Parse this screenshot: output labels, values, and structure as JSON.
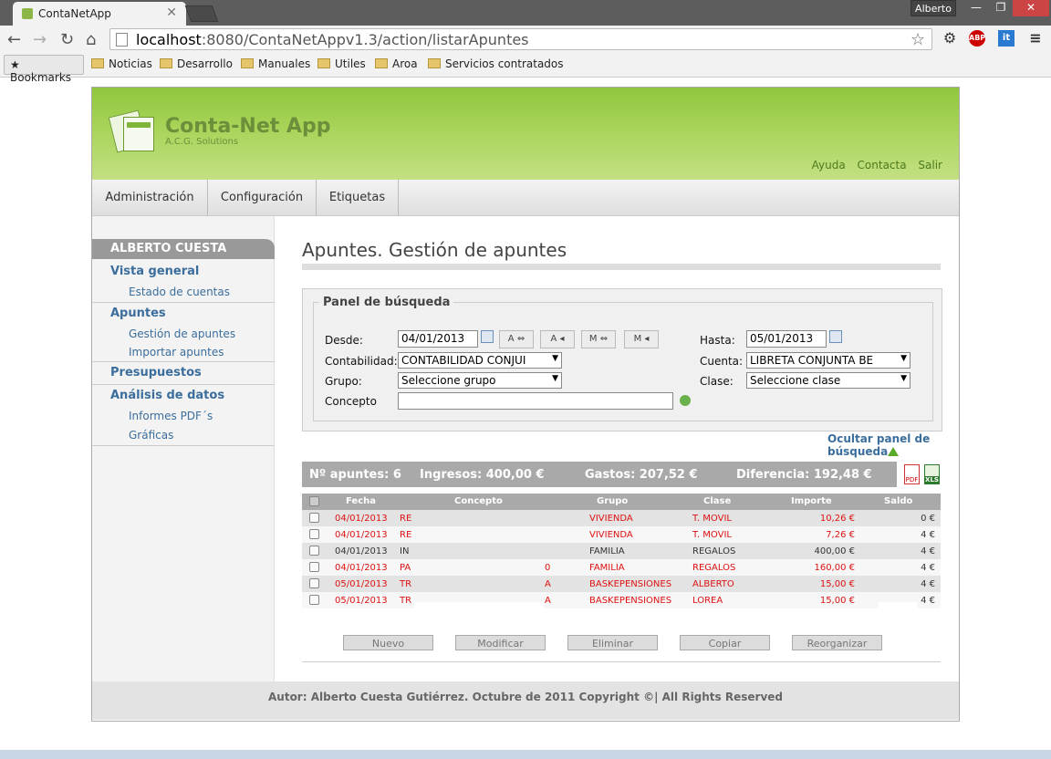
{
  "browser": {
    "tab_title": "ContaNetApp",
    "user": "Alberto",
    "url_host": "localhost",
    "url_path": ":8080/ContaNetAppv1.3/action/listarApuntes",
    "bookmarks_label": "Bookmarks",
    "bookmarks": [
      "Noticias",
      "Desarrollo",
      "Manuales",
      "Utiles",
      "Aroa",
      "Servicios contratados"
    ]
  },
  "site": {
    "title": "Conta-Net App",
    "subtitle": "A.C.G. Solutions",
    "links": [
      "Ayuda",
      "Contacta",
      "Salir"
    ],
    "nav": [
      "Administración",
      "Configuración",
      "Etiquetas"
    ]
  },
  "sidebar": {
    "user": "ALBERTO CUESTA",
    "vista_general": "Vista general",
    "estado_cuentas": "Estado de cuentas",
    "apuntes": "Apuntes",
    "gestion_apuntes": "Gestión de apuntes",
    "importar_apuntes": "Importar apuntes",
    "presupuestos": "Presupuestos",
    "analisis": "Análisis de datos",
    "informes": "Informes PDF´s",
    "graficas": "Gráficas"
  },
  "main": {
    "title": "Apuntes. Gestión de apuntes",
    "panel_title": "Panel de búsqueda",
    "desde_label": "Desde:",
    "desde_value": "04/01/2013",
    "hasta_label": "Hasta:",
    "hasta_value": "05/01/2013",
    "mini_buttons": [
      "A ⇔",
      "A ◂",
      "M ⇔",
      "M ◂"
    ],
    "contabilidad_label": "Contabilidad:",
    "contabilidad_value": "CONTABILIDAD CONJUI",
    "cuenta_label": "Cuenta:",
    "cuenta_value": "LIBRETA CONJUNTA BE",
    "grupo_label": "Grupo:",
    "grupo_value": "Seleccione grupo",
    "clase_label": "Clase:",
    "clase_value": "Seleccione clase",
    "concepto_label": "Concepto",
    "concepto_value": "",
    "hide_panel_line1": "Ocultar panel de",
    "hide_panel_line2": "búsqueda"
  },
  "summary": {
    "num": "Nº apuntes: 6",
    "ingresos": "Ingresos: 400,00 €",
    "gastos": "Gastos: 207,52 €",
    "diferencia": "Diferencia: 192,48 €"
  },
  "table": {
    "headers": [
      "Fecha",
      "Concepto",
      "Grupo",
      "Clase",
      "Importe",
      "Saldo"
    ],
    "rows": [
      {
        "fecha": "04/01/2013",
        "concepto": "RE",
        "concepto_tail": "",
        "grupo": "VIVIENDA",
        "clase": "T. MOVIL",
        "importe": "10,26 €",
        "saldo": "0 €",
        "color": "red"
      },
      {
        "fecha": "04/01/2013",
        "concepto": "RE",
        "concepto_tail": "",
        "grupo": "VIVIENDA",
        "clase": "T. MOVIL",
        "importe": "7,26 €",
        "saldo": "4 €",
        "color": "red"
      },
      {
        "fecha": "04/01/2013",
        "concepto": "IN",
        "concepto_tail": "",
        "grupo": "FAMILIA",
        "clase": "REGALOS",
        "importe": "400,00 €",
        "saldo": "4 €",
        "color": "dark"
      },
      {
        "fecha": "04/01/2013",
        "concepto": "PA",
        "concepto_tail": "0",
        "grupo": "FAMILIA",
        "clase": "REGALOS",
        "importe": "160,00 €",
        "saldo": "4 €",
        "color": "red"
      },
      {
        "fecha": "05/01/2013",
        "concepto": "TR",
        "concepto_tail": "A",
        "grupo": "BASKEPENSIONES",
        "clase": "ALBERTO",
        "importe": "15,00 €",
        "saldo": "4 €",
        "color": "red"
      },
      {
        "fecha": "05/01/2013",
        "concepto": "TR",
        "concepto_tail": "A",
        "grupo": "BASKEPENSIONES",
        "clase": "LOREA",
        "importe": "15,00 €",
        "saldo": "4 €",
        "color": "red"
      }
    ]
  },
  "actions": [
    "Nuevo",
    "Modificar",
    "Eliminar",
    "Copiar",
    "Reorganizar"
  ],
  "footer": "Autor: Alberto Cuesta Gutiérrez. Octubre de 2011 Copyright ©| All Rights Reserved"
}
